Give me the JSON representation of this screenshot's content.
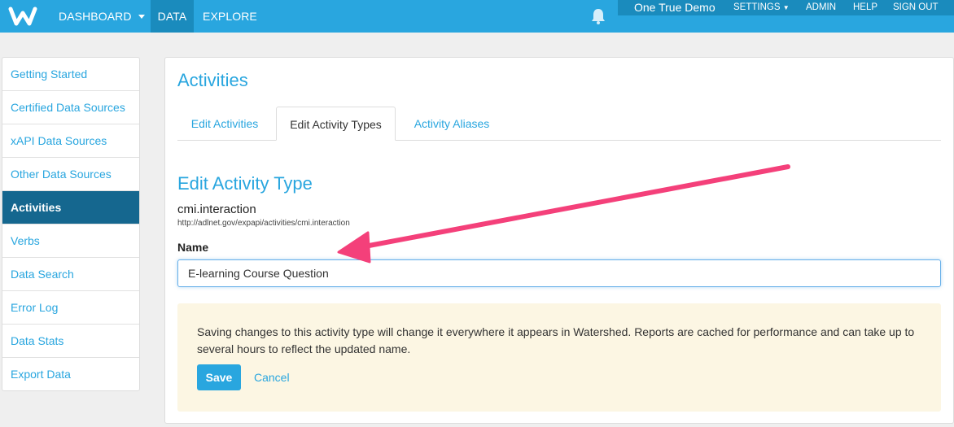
{
  "colors": {
    "brand": "#29a6df",
    "nav_active": "#1a8bbd",
    "sidebar_active": "#15678f",
    "notice_bg": "#fcf6e3",
    "annotation_arrow": "#f4407a"
  },
  "topnav": {
    "logo_icon": "watershed-logo-icon",
    "items": [
      "DASHBOARD",
      "DATA",
      "EXPLORE"
    ],
    "active": "DATA",
    "bell_icon": "bell-icon",
    "org": "One True Demo",
    "settings": "SETTINGS",
    "admin": "ADMIN",
    "help": "HELP",
    "signout": "SIGN OUT"
  },
  "sidebar": {
    "items": [
      {
        "label": "Getting Started"
      },
      {
        "label": "Certified Data Sources"
      },
      {
        "label": "xAPI Data Sources"
      },
      {
        "label": "Other Data Sources"
      },
      {
        "label": "Activities"
      },
      {
        "label": "Verbs"
      },
      {
        "label": "Data Search"
      },
      {
        "label": "Error Log"
      },
      {
        "label": "Data Stats"
      },
      {
        "label": "Export Data"
      }
    ],
    "active": "Activities"
  },
  "main": {
    "title": "Activities",
    "tabs": [
      {
        "label": "Edit Activities"
      },
      {
        "label": "Edit Activity Types"
      },
      {
        "label": "Activity Aliases"
      }
    ],
    "active_tab": "Edit Activity Types",
    "section_title": "Edit Activity Type",
    "type_name": "cmi.interaction",
    "type_uri": "http://adlnet.gov/expapi/activities/cmi.interaction",
    "name_label": "Name",
    "name_value": "E-learning Course Question",
    "notice": "Saving changes to this activity type will change it everywhere it appears in Watershed. Reports are cached for performance and can take up to several hours to reflect the updated name.",
    "save_label": "Save",
    "cancel_label": "Cancel"
  }
}
